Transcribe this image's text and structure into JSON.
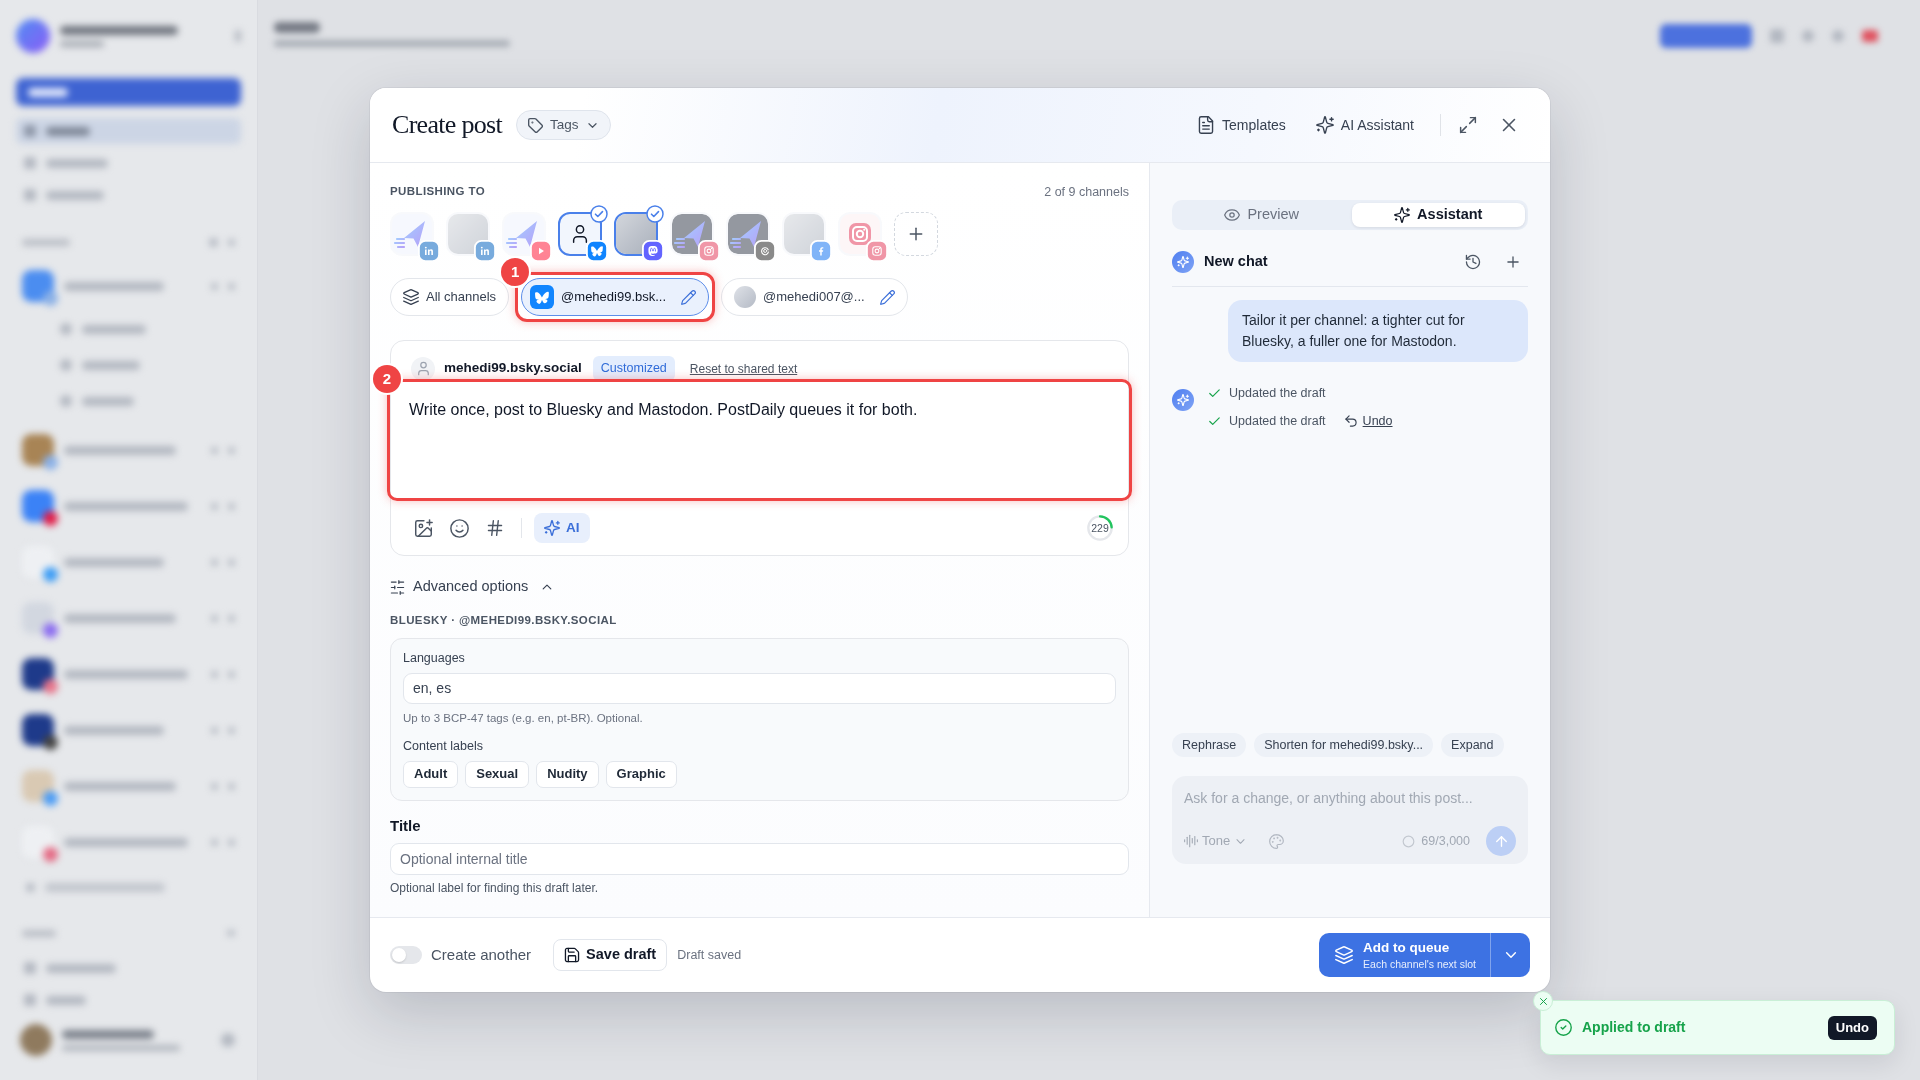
{
  "dialog": {
    "title": "Create post",
    "tags": "Tags",
    "actions": [
      "Templates",
      "AI Assistant"
    ]
  },
  "publishing": {
    "heading": "PUBLISHING TO",
    "count": "2 of 9 channels",
    "channels": [
      {
        "selected": false
      },
      {
        "selected": false
      },
      {
        "selected": false
      },
      {
        "selected": true
      },
      {
        "selected": true
      },
      {
        "selected": false
      },
      {
        "selected": false
      },
      {
        "selected": false
      },
      {
        "selected": false
      }
    ],
    "chips": [
      {
        "kind": "all",
        "label": "All channels",
        "selected": false
      },
      {
        "kind": "account",
        "label": "@mehedi99.bsk...",
        "selected": true,
        "annotation": "1"
      },
      {
        "kind": "account",
        "label": "@mehedi007@...",
        "selected": false
      }
    ]
  },
  "editor": {
    "account": "mehedi99.bsky.social",
    "badge": "Customized",
    "reset": "Reset to shared text",
    "annotation": "2",
    "text": "Write once, post to Bluesky and Mastodon. PostDaily queues it for both.",
    "ai": "AI",
    "count": "229",
    "level": 0.24
  },
  "advanced": {
    "label": "Advanced options",
    "expanded": true,
    "section": "BLUESKY · @MEHEDI99.BSKY.SOCIAL",
    "languages": {
      "label": "Languages",
      "value": "en, es",
      "help": "Up to 3 BCP-47 tags (e.g. en, pt-BR). Optional."
    },
    "labels": {
      "label": "Content labels",
      "options": [
        {
          "label": "Adult",
          "selected": false
        },
        {
          "label": "Sexual",
          "selected": false
        },
        {
          "label": "Nudity",
          "selected": false
        },
        {
          "label": "Graphic",
          "selected": false
        }
      ]
    }
  },
  "title_field": {
    "label": "Title",
    "placeholder": "Optional internal title",
    "help": "Optional label for finding this draft later."
  },
  "footer": {
    "create_another": {
      "label": "Create another",
      "on": false
    },
    "save": "Save draft",
    "status": "Draft saved",
    "submit": {
      "label": "Add to queue",
      "sublabel": "Each channel's next slot"
    }
  },
  "assistant": {
    "tabs": [
      {
        "label": "Preview",
        "selected": false
      },
      {
        "label": "Assistant",
        "selected": true
      }
    ],
    "chat_title": "New chat",
    "messages": [
      {
        "kind": "user",
        "text": "Tailor it per channel: a tighter cut for Bluesky, a fuller one for Mastodon."
      },
      {
        "kind": "assistant",
        "steps": [
          {
            "text": "Updated the draft"
          },
          {
            "text": "Updated the draft",
            "undo": "Undo"
          }
        ]
      }
    ],
    "suggestions": [
      "Rephrase",
      "Shorten for mehedi99.bsky...",
      "Expand"
    ],
    "composer": {
      "placeholder": "Ask for a change, or anything about this post...",
      "tone": "Tone",
      "count": "69/3,000",
      "disabled": true
    }
  },
  "toast": {
    "text": "Applied to draft",
    "action": "Undo"
  }
}
